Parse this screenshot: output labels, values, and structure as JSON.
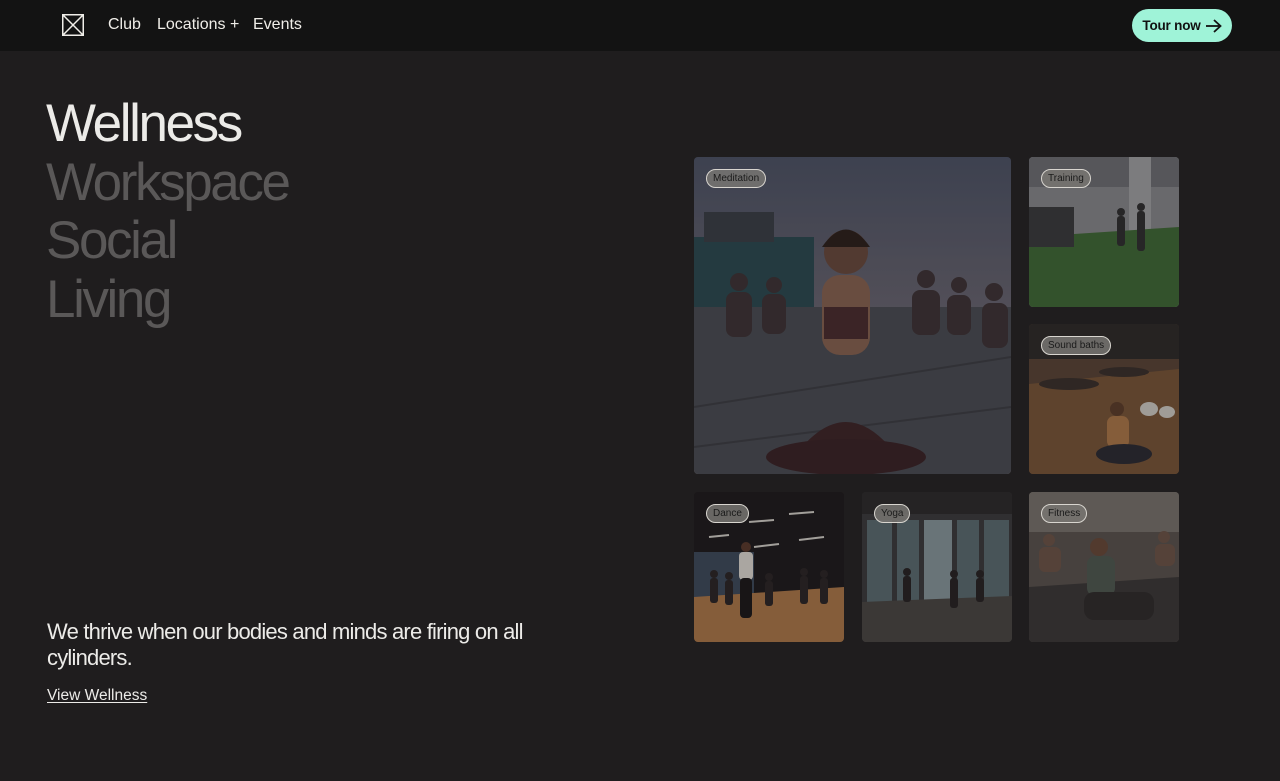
{
  "nav": {
    "logo_icon": "x-box-logo-icon",
    "links": [
      "Club",
      "Locations +",
      "Events"
    ],
    "cta_label": "Tour now",
    "cta_icon": "arrow-right-icon",
    "cta_color": "#9ff3d8"
  },
  "categories": {
    "items": [
      "Wellness",
      "Workspace",
      "Social",
      "Living"
    ],
    "active": "Wellness"
  },
  "wellness": {
    "tagline": "We thrive when our bodies and minds are firing on all cylinders.",
    "link_label": "View Wellness"
  },
  "gallery": {
    "tiles": [
      {
        "label": "Meditation"
      },
      {
        "label": "Training"
      },
      {
        "label": "Sound baths"
      },
      {
        "label": "Dance"
      },
      {
        "label": "Yoga"
      },
      {
        "label": "Fitness"
      }
    ]
  },
  "colors": {
    "background": "#1f1d1e",
    "navbar": "#131313",
    "text_active": "#ecebe8",
    "text_inactive": "#5a5858"
  }
}
